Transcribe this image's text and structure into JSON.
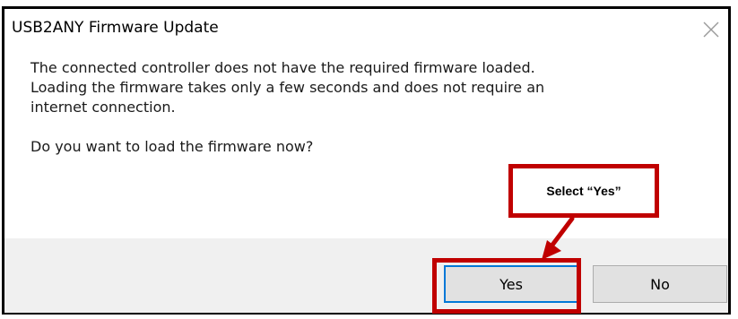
{
  "dialog": {
    "title": "USB2ANY Firmware Update",
    "close_icon": "close-icon",
    "message_line_1": "The connected controller does not have the required firmware loaded.",
    "message_line_2": "Loading the firmware takes only a few seconds and does not require an",
    "message_line_3": "internet connection.",
    "question": "Do you want to load the firmware now?",
    "yes_label": "Yes",
    "no_label": "No"
  },
  "annotation": {
    "callout_text": "Select “Yes”",
    "highlight_color": "#c00000"
  },
  "colors": {
    "accent": "#0078d7",
    "footer_bg": "#f0f0f0",
    "button_bg": "#e1e1e1"
  }
}
